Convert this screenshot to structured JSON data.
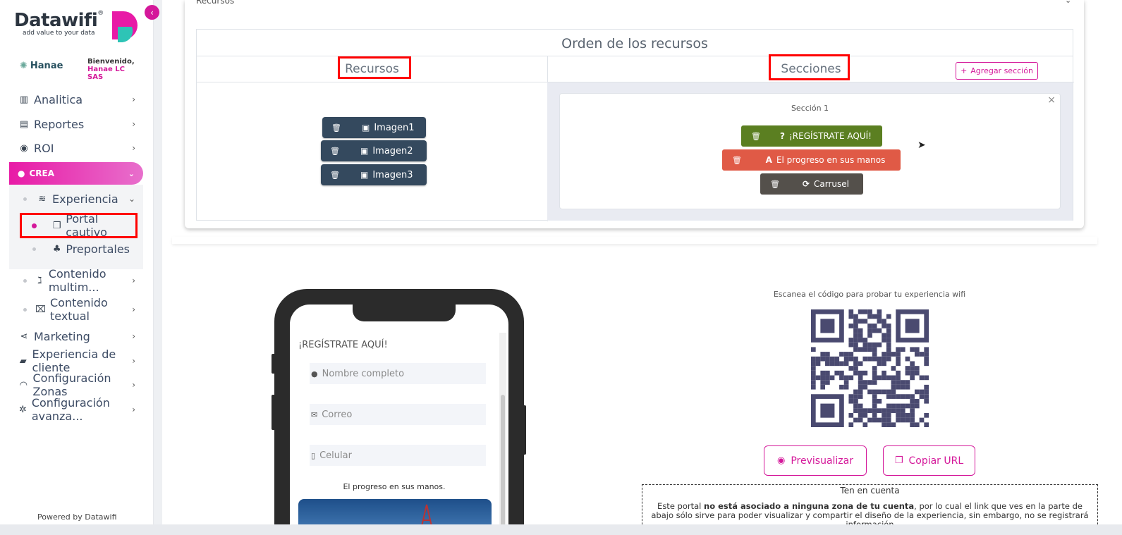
{
  "sidebar": {
    "brand": "Datawifi",
    "brand_registered": "®",
    "tagline": "add value to your data",
    "collapse_icon": "chevron-left-icon",
    "client_logo": "Hanae",
    "welcome": "Bienvenido,",
    "company": "Hanae LC SAS",
    "items": [
      {
        "label": "Analitica",
        "icon": "chart-icon"
      },
      {
        "label": "Reportes",
        "icon": "document-icon"
      },
      {
        "label": "ROI",
        "icon": "money-icon"
      },
      {
        "label": "CREA",
        "icon": "lightbulb-icon"
      },
      {
        "label": "Experiencia",
        "icon": "layers-icon"
      },
      {
        "label": "Portal cautivo",
        "icon": "copy-icon"
      },
      {
        "label": "Preportales",
        "icon": "shapes-icon"
      },
      {
        "label": "Contenido multim...",
        "icon": "rss-icon"
      },
      {
        "label": "Contenido textual",
        "icon": "inbox-icon"
      },
      {
        "label": "Marketing",
        "icon": "share-icon"
      },
      {
        "label": "Experiencia de cliente",
        "icon": "thumbs-up-icon"
      },
      {
        "label": "Configuración Zonas",
        "icon": "wifi-icon"
      },
      {
        "label": "Configuración avanza...",
        "icon": "gear-icon"
      }
    ],
    "powered": "Powered by Datawifi"
  },
  "card": {
    "collapsed_label": "Recursos",
    "title": "Orden de los recursos",
    "col_recursos": "Recursos",
    "col_secciones": "Secciones",
    "add_section": "Agregar sección",
    "resources": [
      "Imagen1",
      "Imagen2",
      "Imagen3"
    ],
    "section_title": "Sección 1",
    "section_items": [
      {
        "label": "¡REGÍSTRATE AQUÍ!",
        "color": "#5b7f21",
        "icon": "question-icon"
      },
      {
        "label": "El progreso en sus manos",
        "color": "#e05a46",
        "icon": "font-icon"
      },
      {
        "label": "Carrusel",
        "color": "#54504b",
        "icon": "refresh-icon"
      }
    ]
  },
  "phone": {
    "title": "¡REGÍSTRATE AQUÍ!",
    "fields": [
      {
        "placeholder": "Nombre completo",
        "icon": "user-icon"
      },
      {
        "placeholder": "Correo",
        "icon": "envelope-icon"
      },
      {
        "placeholder": "Celular",
        "icon": "mobile-icon"
      }
    ],
    "text": "El progreso en sus manos."
  },
  "qr": {
    "label": "Escanea el código para probar tu experiencia wifi",
    "preview": "Previsualizar",
    "copy_url": "Copiar URL"
  },
  "note": {
    "title": "Ten en cuenta",
    "prefix": "Este portal ",
    "bold": "no está asociado a ninguna zona de tu cuenta",
    "suffix": ", por lo cual el link que ves en la parte de abajo sólo sirve para poder visualizar y compartir el diseño de la experiencia, sin embargo, no se registrará información"
  },
  "colors": {
    "accent": "#d4189a",
    "resource_btn": "#34495e",
    "highlight": "#ff0000"
  }
}
